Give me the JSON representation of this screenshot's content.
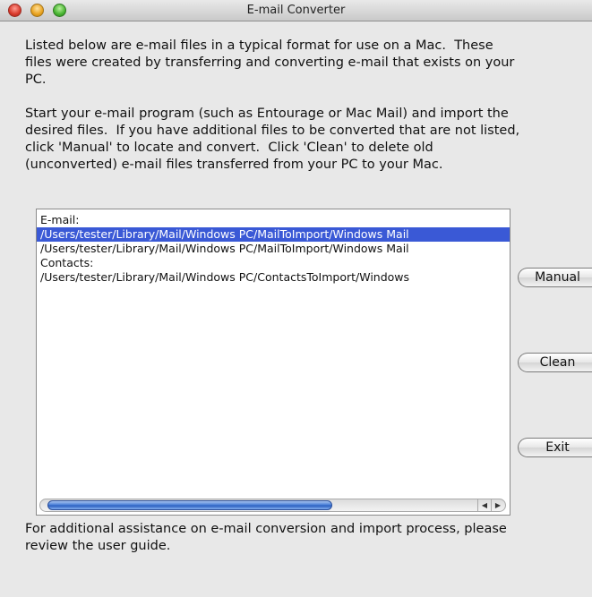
{
  "window": {
    "title": "E-mail Converter"
  },
  "instructions": {
    "paragraph1": "Listed below are e-mail files in a typical format for use on a Mac.  These\nfiles were created by transferring and converting e-mail that exists on your\nPC.",
    "paragraph2": "Start your e-mail program (such as Entourage or Mac Mail) and import the\ndesired files.  If you have additional files to be converted that are not listed,\nclick 'Manual' to locate and convert.  Click 'Clean' to delete old\n(unconverted) e-mail files transferred from your PC to your Mac.",
    "footer": "For additional assistance on e-mail conversion and import process, please\nreview the user guide."
  },
  "file_list": {
    "rows": [
      "E-mail:",
      "/Users/tester/Library/Mail/Windows PC/MailToImport/Windows Mail",
      "/Users/tester/Library/Mail/Windows PC/MailToImport/Windows Mail",
      "Contacts:",
      "/Users/tester/Library/Mail/Windows PC/ContactsToImport/Windows"
    ],
    "selected_index": 1
  },
  "buttons": {
    "manual": "Manual",
    "clean": "Clean",
    "exit": "Exit"
  },
  "scrollbar": {
    "left_arrow": "◀",
    "right_arrow": "▶"
  },
  "colors": {
    "selection": "#3a59d6",
    "background": "#e8e8e8"
  }
}
